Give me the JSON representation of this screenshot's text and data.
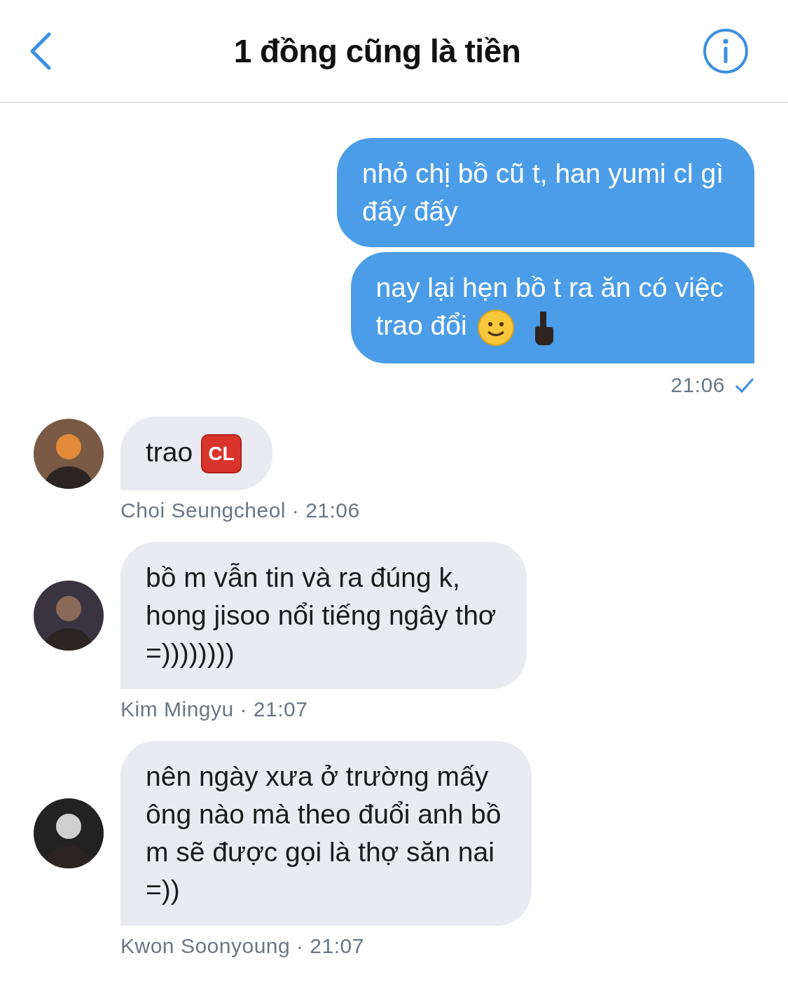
{
  "header": {
    "title": "1 đồng cũng là tiền"
  },
  "sent": {
    "messages": [
      {
        "lines": [
          "nhỏ chị bồ cũ t, han yumi cl gì",
          "đấy đấy"
        ]
      },
      {
        "lines": [
          "nay lại hẹn bồ t ra ăn có việc",
          "trao đổi"
        ],
        "emojis": [
          {
            "kind": "smiley"
          },
          {
            "kind": "finger"
          }
        ]
      }
    ],
    "time": "21:06",
    "delivered": true
  },
  "received": [
    {
      "lines": [
        "trao"
      ],
      "emojis": [
        {
          "kind": "badge",
          "label": "CL"
        }
      ],
      "sender": "Choi Seungcheol · 21:06"
    },
    {
      "lines": [
        "bồ m vẫn tin và ra đúng k,",
        "hong jisoo nổi tiếng ngây thơ",
        "=))))))))"
      ],
      "sender": "Kim Mingyu · 21:07"
    },
    {
      "lines": [
        "nên ngày xưa ở trường mấy",
        "ông nào mà theo đuổi anh bồ",
        "m sẽ được gọi là thợ săn nai",
        "=))"
      ],
      "sender": "Kwon Soonyoung · 21:07"
    }
  ]
}
